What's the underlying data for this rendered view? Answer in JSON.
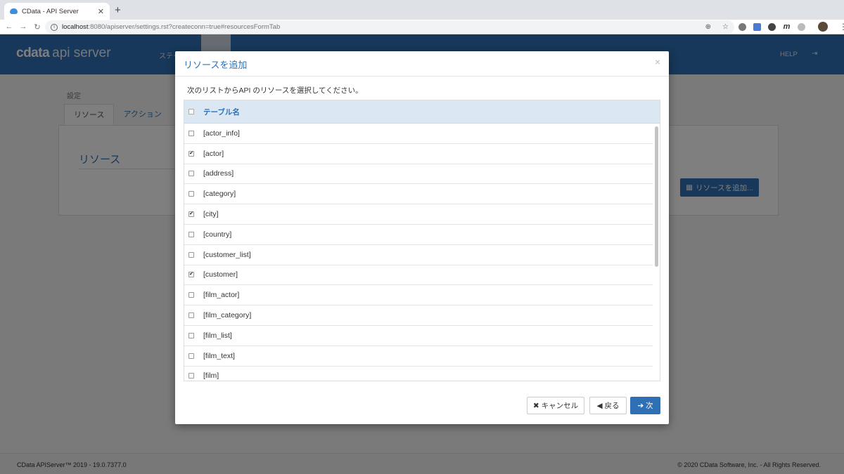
{
  "browser": {
    "tab_title": "CData - API Server",
    "new_tab": "+",
    "tab_close": "✕",
    "url_host": "localhost",
    "url_rest": ":8080/apiserver/settings.rst?createconn=true#resourcesFormTab"
  },
  "header": {
    "brand_cdata": "cdata",
    "brand_product": "api server",
    "nav_item_partial": "ステー",
    "help": "HELP"
  },
  "page": {
    "breadcrumb": "設定",
    "tabs": [
      {
        "label": "リソース",
        "active": true
      },
      {
        "label": "アクション",
        "active": false
      }
    ],
    "panel_title": "リソース",
    "add_resource_button": "リソースを追加..."
  },
  "footer": {
    "left": "CData APIServer™ 2019 - 19.0.7377.0",
    "right": "© 2020 CData Software, Inc. - All Rights Reserved."
  },
  "modal": {
    "title": "リソースを追加",
    "close": "×",
    "description": "次のリストからAPI のリソースを選択してください。",
    "column_header": "テーブル名",
    "rows": [
      {
        "label": "[actor_info]",
        "checked": false
      },
      {
        "label": "[actor]",
        "checked": true
      },
      {
        "label": "[address]",
        "checked": false
      },
      {
        "label": "[category]",
        "checked": false
      },
      {
        "label": "[city]",
        "checked": true
      },
      {
        "label": "[country]",
        "checked": false
      },
      {
        "label": "[customer_list]",
        "checked": false
      },
      {
        "label": "[customer]",
        "checked": true
      },
      {
        "label": "[film_actor]",
        "checked": false
      },
      {
        "label": "[film_category]",
        "checked": false
      },
      {
        "label": "[film_list]",
        "checked": false
      },
      {
        "label": "[film_text]",
        "checked": false
      },
      {
        "label": "[film]",
        "checked": false
      }
    ],
    "buttons": {
      "cancel": "キャンセル",
      "back": "戻る",
      "next": "次"
    }
  }
}
